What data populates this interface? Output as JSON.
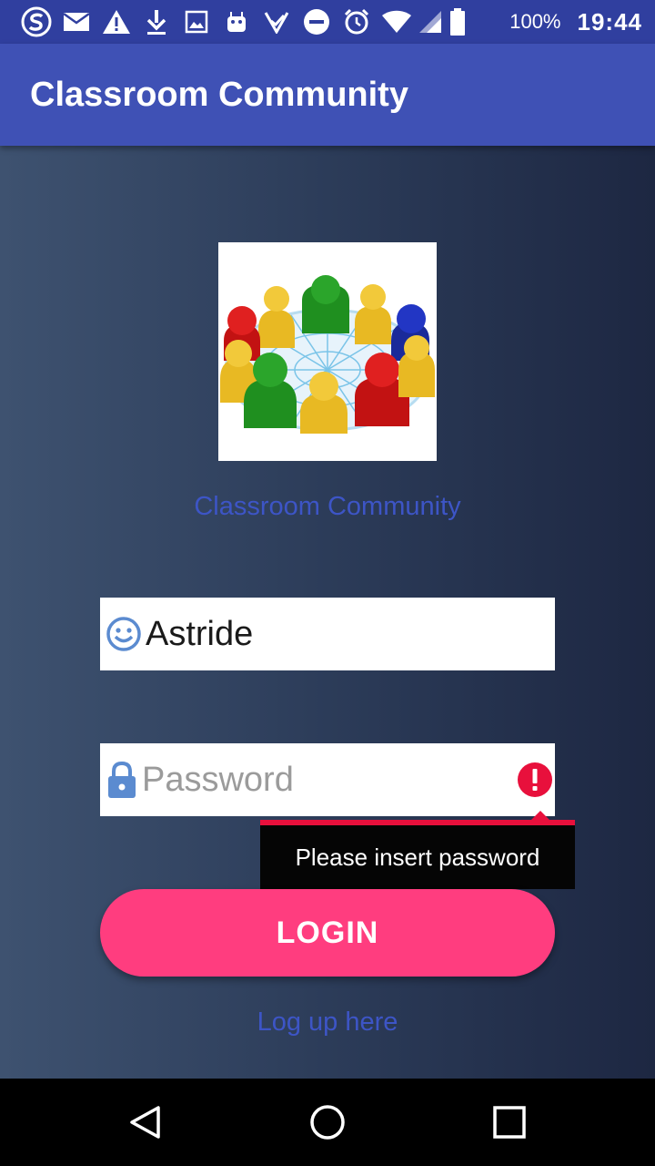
{
  "status_bar": {
    "icons": [
      "s-app-icon",
      "mail-icon",
      "warning-icon",
      "download-icon",
      "image-icon",
      "android-icon",
      "check-icon",
      "dnd-icon",
      "alarm-icon",
      "wifi-icon",
      "signal-icon",
      "battery-icon"
    ],
    "battery_percent": "100%",
    "time": "19:44"
  },
  "app_bar": {
    "title": "Classroom Community"
  },
  "logo": {
    "caption": "Classroom Community"
  },
  "username_field": {
    "value": "Astride",
    "icon": "smiley-icon"
  },
  "password_field": {
    "placeholder": "Password",
    "value": "",
    "icon": "lock-icon",
    "error_icon": "error-icon"
  },
  "error_tooltip": {
    "text": "Please insert password"
  },
  "login_button": {
    "label": "LOGIN"
  },
  "signup_link": {
    "label": "Log up here"
  },
  "colors": {
    "primary_dark": "#303f9f",
    "primary": "#3f51b5",
    "accent": "#ff3d7f",
    "error": "#e8103c",
    "link": "#3d55c6"
  },
  "nav_bar": {
    "buttons": [
      "back-icon",
      "home-icon",
      "recents-icon"
    ]
  }
}
